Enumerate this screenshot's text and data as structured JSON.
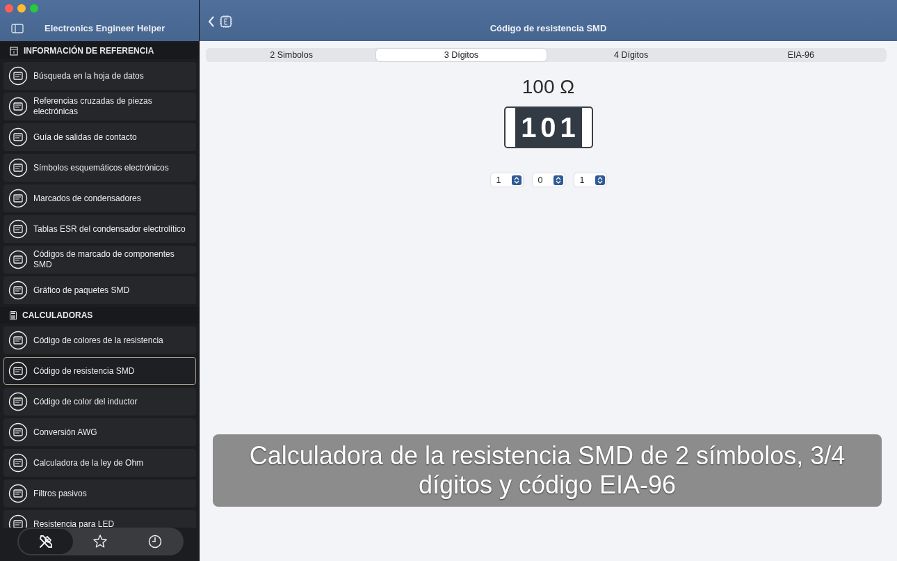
{
  "window": {
    "app_title": "Electronics Engineer Helper",
    "page_title": "Código de resistencia SMD"
  },
  "sidebar": {
    "sections": [
      {
        "title": "INFORMACIÓN DE REFERENCIA",
        "kind": "book",
        "items": [
          {
            "label": "Búsqueda en la hoja de datos",
            "selected": false
          },
          {
            "label": "Referencias cruzadas de piezas electrónicas",
            "selected": false
          },
          {
            "label": "Guía de salidas de contacto",
            "selected": false
          },
          {
            "label": "Símbolos esquemáticos electrónicos",
            "selected": false
          },
          {
            "label": "Marcados de condensadores",
            "selected": false
          },
          {
            "label": "Tablas ESR del condensador electrolítico",
            "selected": false
          },
          {
            "label": "Códigos de marcado de componentes SMD",
            "selected": false
          },
          {
            "label": "Gráfico de paquetes SMD",
            "selected": false
          }
        ]
      },
      {
        "title": "CALCULADORAS",
        "kind": "calculator",
        "items": [
          {
            "label": "Código de colores de la resistencia",
            "selected": false
          },
          {
            "label": "Código de resistencia SMD",
            "selected": true
          },
          {
            "label": "Código de color del inductor",
            "selected": false
          },
          {
            "label": "Conversión AWG",
            "selected": false
          },
          {
            "label": "Calculadora de la ley de Ohm",
            "selected": false
          },
          {
            "label": "Filtros pasivos",
            "selected": false
          },
          {
            "label": "Resistencia para LED",
            "selected": false
          }
        ]
      }
    ]
  },
  "bottom_tabs": [
    {
      "kind": "tools",
      "selected": true
    },
    {
      "kind": "star",
      "selected": false
    },
    {
      "kind": "clock",
      "selected": false
    }
  ],
  "tabs": [
    {
      "label": "2 Simbolos",
      "selected": false
    },
    {
      "label": "3 Dígitos",
      "selected": true
    },
    {
      "label": "4 Dígitos",
      "selected": false
    },
    {
      "label": "EIA-96",
      "selected": false
    }
  ],
  "result": "100 Ω",
  "chip_code": "101",
  "digits": [
    "1",
    "0",
    "1"
  ],
  "caption": "Calculadora de la resistencia SMD de 2 símbolos, 3/4 dígitos y código EIA-96"
}
